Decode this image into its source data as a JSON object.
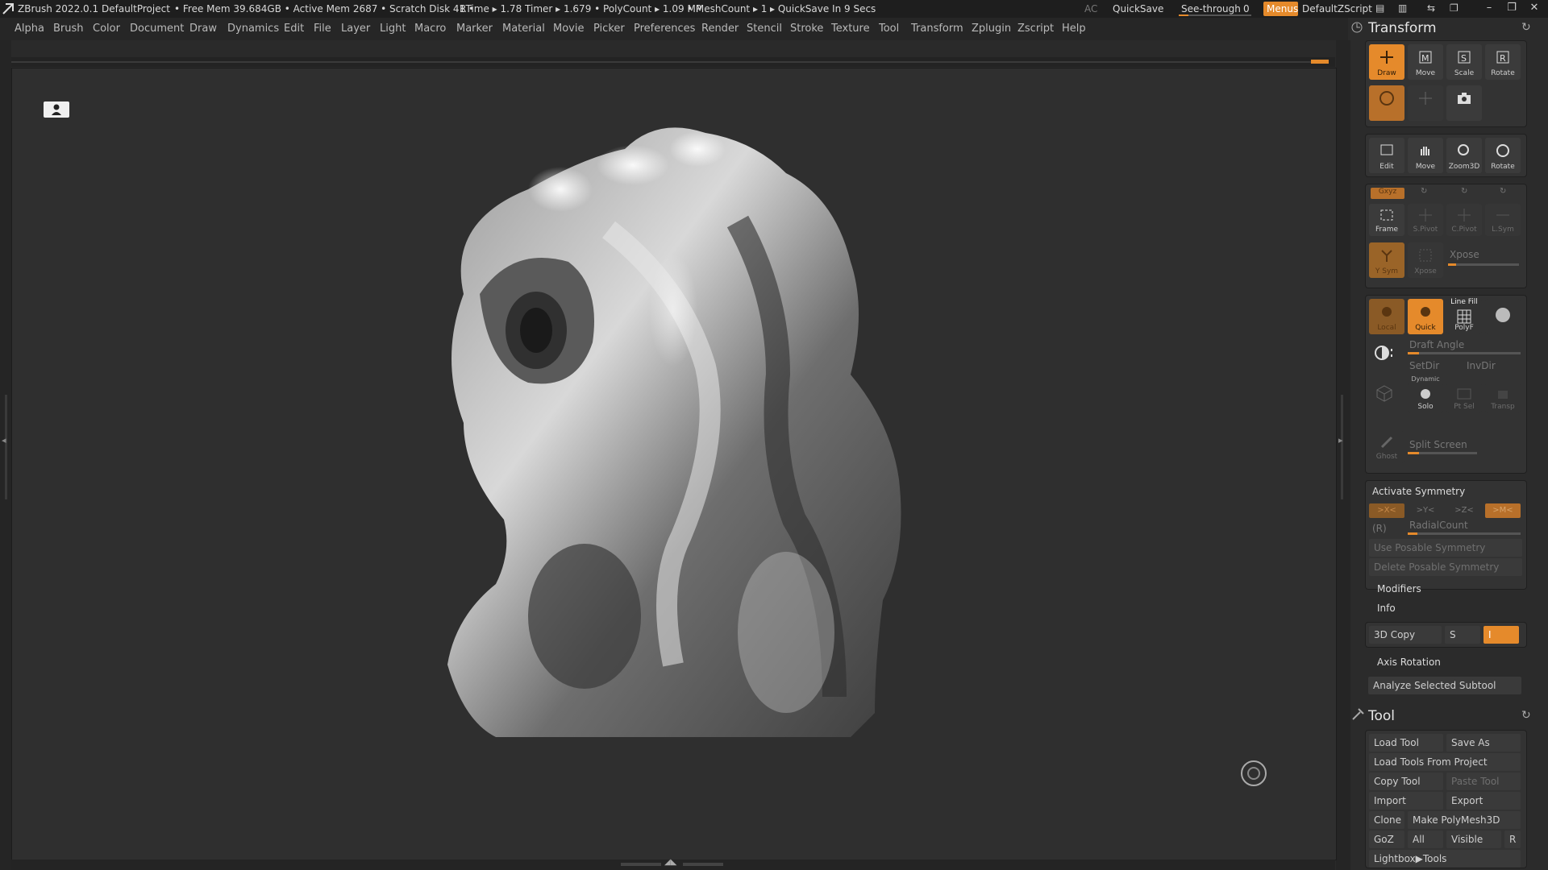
{
  "title_bar": {
    "app": "ZBrush 2022.0.1",
    "project": "DefaultProject",
    "stats": "• Free Mem 39.684GB • Active Mem 2687 • Scratch Disk 41 •",
    "timers": "RTime ▸ 1.78 Timer ▸ 1.679 • PolyCount ▸ 1.09 MP",
    "mesh": "• MeshCount ▸ 1",
    "quicksave_info": "▸ QuickSave In 9 Secs",
    "ac": "AC",
    "quicksave": "QuickSave",
    "see_through": "See-through",
    "see_through_value": "0",
    "menus": "Menus",
    "script": "DefaultZScript"
  },
  "menu_items": [
    "Alpha",
    "Brush",
    "Color",
    "Document",
    "Draw",
    "Dynamics",
    "Edit",
    "File",
    "Layer",
    "Light",
    "Macro",
    "Marker",
    "Material",
    "Movie",
    "Picker",
    "Preferences",
    "Render",
    "Stencil",
    "Stroke",
    "Texture",
    "Tool",
    "Transform",
    "Zplugin",
    "Zscript",
    "Help"
  ],
  "transform": {
    "title": "Transform",
    "top_buttons": [
      "Draw",
      "Move",
      "Scale",
      "Rotate"
    ],
    "view_buttons": [
      "Edit",
      "Move",
      "Zoom3D",
      "Rotate"
    ],
    "axis_label": "Gxyz",
    "frame_row": [
      "Frame",
      "S.Pivot",
      "C.Pivot",
      "L.Sym"
    ],
    "ysym": "Y Sym",
    "xpose_btn": "Xpose",
    "xpose": "Xpose",
    "local": "Local",
    "quick": "Quick",
    "line_fill": "Line Fill",
    "polyf": "PolyF",
    "draft_angle": "Draft Angle",
    "setdir": "SetDir",
    "invdir": "InvDir",
    "dynamic": "Dynamic",
    "solo": "Solo",
    "ptsel": "Pt Sel",
    "transp": "Transp",
    "split_screen": "Split Screen",
    "ghost": "Ghost",
    "activate_symmetry": "Activate Symmetry",
    "sym_axes": [
      ">X<",
      ">Y<",
      ">Z<",
      ">M<"
    ],
    "r_label": "(R)",
    "radial_count": "RadialCount",
    "use_posable": "Use Posable Symmetry",
    "delete_posable": "Delete Posable Symmetry",
    "modifiers": "Modifiers",
    "info": "Info",
    "copy3d": "3D Copy",
    "s": "S",
    "i": "I",
    "axis_rotation": "Axis Rotation",
    "analyze": "Analyze Selected Subtool"
  },
  "tool": {
    "title": "Tool",
    "load_tool": "Load Tool",
    "save_as": "Save As",
    "load_from_project": "Load Tools From Project",
    "copy_tool": "Copy Tool",
    "paste_tool": "Paste Tool",
    "import": "Import",
    "export": "Export",
    "clone": "Clone",
    "make_polymesh": "Make PolyMesh3D",
    "goz": "GoZ",
    "all": "All",
    "visible": "Visible",
    "r": "R",
    "lightbox": "Lightbox▶Tools"
  },
  "colors": {
    "accent": "#e58a2b",
    "panel": "#2b2b2b",
    "canvas": "#2f2f2f"
  }
}
